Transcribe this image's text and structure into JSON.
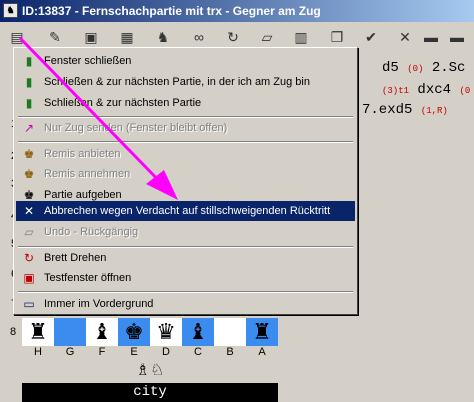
{
  "window": {
    "title": "ID:13837 - Fernschachpartie mit trx - Gegner am Zug",
    "icon": "board-icon"
  },
  "toolbar": {
    "icons": [
      "menu-icon",
      "edit-icon",
      "save-icon",
      "board-icon",
      "camel-icon",
      "chain-icon",
      "rotate-icon",
      "eraser-icon",
      "window-icon",
      "copy-icon",
      "check-icon",
      "close-icon",
      "minus-icon",
      "minus-icon"
    ]
  },
  "menu": {
    "items": [
      {
        "label": "Fenster schließen",
        "icon": "exit-icon",
        "enabled": true
      },
      {
        "label": "Schließen & zur nächsten Partie, in der ich am Zug bin",
        "icon": "exit-icon",
        "enabled": true
      },
      {
        "label": "Schließen & zur nächsten Partie",
        "icon": "exit-icon",
        "enabled": true
      },
      {
        "label": "Nur Zug senden (Fenster bleibt offen)",
        "icon": "send-icon",
        "enabled": false
      },
      {
        "label": "Remis anbieten",
        "icon": "draw-offer-icon",
        "enabled": false
      },
      {
        "label": "Remis annehmen",
        "icon": "draw-accept-icon",
        "enabled": false
      },
      {
        "label": "Partie aufgeben",
        "icon": "resign-icon",
        "enabled": true
      },
      {
        "label": "Abbrechen wegen Verdacht auf stillschweigenden Rücktritt",
        "icon": "abort-icon",
        "enabled": true,
        "highlighted": true
      },
      {
        "label": "Undo - Rückgängig",
        "icon": "undo-icon",
        "enabled": false
      },
      {
        "label": "Brett Drehen",
        "icon": "rotate-icon",
        "enabled": true
      },
      {
        "label": "Testfenster öffnen",
        "icon": "test-window-icon",
        "enabled": true
      },
      {
        "label": "Immer im Vordergrund",
        "icon": "topmost-icon",
        "enabled": true
      }
    ]
  },
  "notation": {
    "line1": "d5",
    "line1_sup": "(0)",
    "line1_tail": "2.Sc",
    "line2_sup": "(3)t1",
    "line2": "dxc4",
    "line2_tail": "(0",
    "line3": "7.exd5",
    "line3_sup": "(1,R)"
  },
  "left_numbers": [
    "1",
    "2",
    "3",
    "4",
    "5",
    "6",
    "7"
  ],
  "board": {
    "rank_label": "8",
    "files": [
      "H",
      "G",
      "F",
      "E",
      "D",
      "C",
      "B",
      "A"
    ],
    "rank8": [
      "♜",
      "",
      "♝",
      "♚",
      "♛",
      "♝",
      "",
      "♜"
    ],
    "captured": "♗♘"
  },
  "player": {
    "city": "city"
  },
  "colors": {
    "highlight": "#0a246a",
    "dark_square": "#3c8cf0",
    "arrow": "#ff00ff"
  }
}
